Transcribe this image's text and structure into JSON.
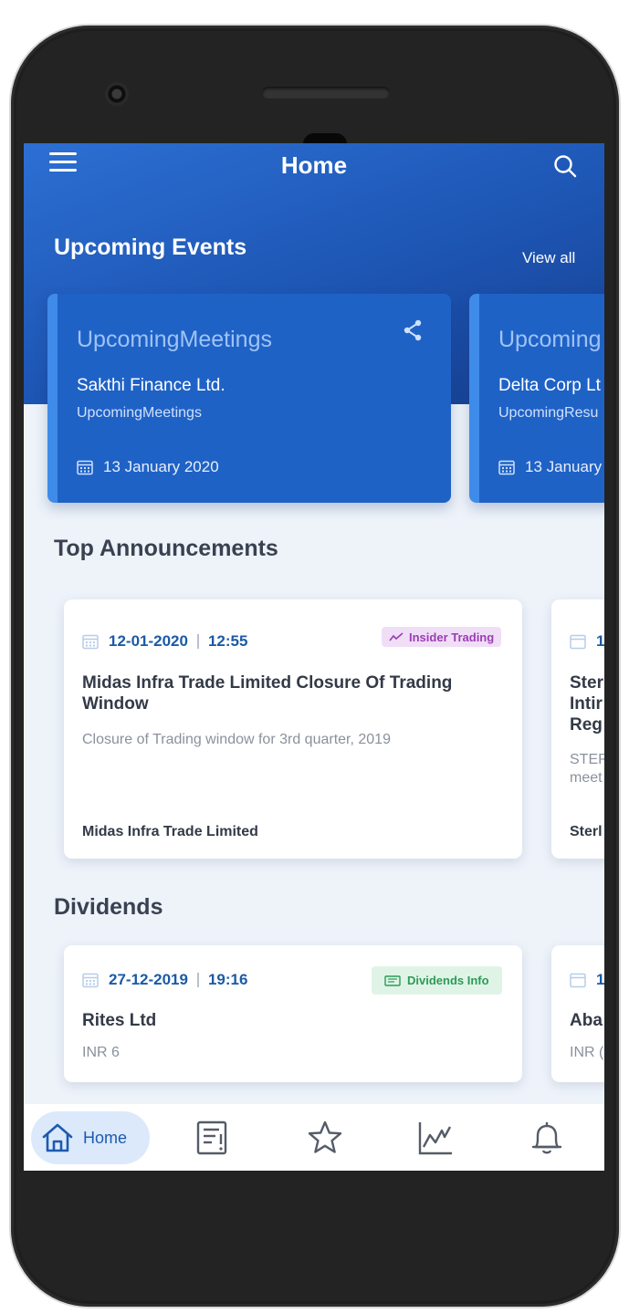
{
  "app": {
    "title": "Home",
    "colors": {
      "primary": "#1f62c6",
      "accent": "#3f8bea",
      "text_dark": "#333a47",
      "date_blue": "#1b5aa6"
    }
  },
  "header": {
    "menu_icon": "hamburger-icon",
    "search_icon": "search-icon"
  },
  "upcoming_events": {
    "title": "Upcoming Events",
    "view_all": "View all",
    "cards": [
      {
        "type": "UpcomingMeetings",
        "company": "Sakthi Finance Ltd.",
        "subtitle": "UpcomingMeetings",
        "date": "13 January 2020"
      },
      {
        "type": "Upcoming",
        "company": "Delta Corp Lt",
        "subtitle": "UpcomingResu",
        "date": "13 January 2"
      }
    ]
  },
  "top_announcements": {
    "title": "Top Announcements",
    "cards": [
      {
        "date": "12-01-2020",
        "time": "12:55",
        "tag": "Insider Trading",
        "title": "Midas Infra Trade Limited Closure Of Trading Window",
        "description": "Closure of Trading window for 3rd quarter, 2019",
        "company": "Midas Infra Trade Limited"
      },
      {
        "date": "1",
        "title_lines": [
          "Ster",
          "Intir",
          "Reg"
        ],
        "description_lines": [
          "STER",
          "meet"
        ],
        "company": "Sterl"
      }
    ]
  },
  "dividends": {
    "title": "Dividends",
    "cards": [
      {
        "date": "27-12-2019",
        "time": "19:16",
        "tag": "Dividends Info",
        "name": "Rites Ltd",
        "value": "INR  6"
      },
      {
        "date": "1",
        "name": "Aba",
        "value": "INR  ("
      }
    ]
  },
  "bottom_nav": {
    "items": [
      {
        "label": "Home",
        "icon": "home-icon",
        "active": true
      },
      {
        "label": "",
        "icon": "announcements-icon",
        "active": false
      },
      {
        "label": "",
        "icon": "star-icon",
        "active": false
      },
      {
        "label": "",
        "icon": "chart-icon",
        "active": false
      },
      {
        "label": "",
        "icon": "bell-icon",
        "active": false
      }
    ]
  }
}
